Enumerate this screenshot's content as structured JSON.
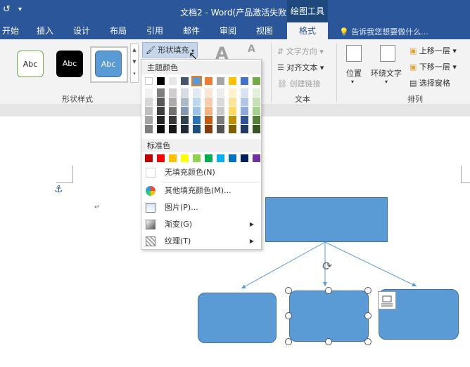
{
  "window": {
    "title": "文档2 - Word(产品激活失败)",
    "context_tab_group": "绘图工具"
  },
  "tabs": [
    {
      "label": "开始"
    },
    {
      "label": "插入"
    },
    {
      "label": "设计"
    },
    {
      "label": "布局"
    },
    {
      "label": "引用"
    },
    {
      "label": "邮件"
    },
    {
      "label": "审阅"
    },
    {
      "label": "视图"
    },
    {
      "label": "格式"
    }
  ],
  "tell_me": "告诉我您想要做什么...",
  "ribbon": {
    "shape_styles": {
      "label": "形状样式",
      "swatches": [
        "Abc",
        "Abc",
        "Abc"
      ],
      "shape_fill": "形状填充"
    },
    "text": {
      "label": "文本",
      "text_direction": "文字方向",
      "align_text": "对齐文本",
      "create_link": "创建链接"
    },
    "arrange": {
      "label": "排列",
      "position": "位置",
      "wrap_text": "环绕文字",
      "bring_forward": "上移一层",
      "send_backward": "下移一层",
      "selection_pane": "选择窗格"
    }
  },
  "fill_menu": {
    "theme_colors_label": "主题颜色",
    "standard_colors_label": "标准色",
    "theme_colors": [
      "#ffffff",
      "#000000",
      "#e7e6e6",
      "#44546a",
      "#5b9bd5",
      "#ed7d31",
      "#a5a5a5",
      "#ffc000",
      "#4472c4",
      "#70ad47"
    ],
    "theme_tints": [
      [
        "#f2f2f2",
        "#7f7f7f",
        "#d0cece",
        "#d6dce4",
        "#deebf6",
        "#fbe5d5",
        "#ededed",
        "#fff2cc",
        "#d9e2f3",
        "#e2efd9"
      ],
      [
        "#d8d8d8",
        "#595959",
        "#aeabab",
        "#adb9ca",
        "#bdd7ee",
        "#f7cbac",
        "#dbdbdb",
        "#fee599",
        "#b4c6e7",
        "#c5e0b3"
      ],
      [
        "#bfbfbf",
        "#3f3f3f",
        "#757070",
        "#8496b0",
        "#9cc3e5",
        "#f4b183",
        "#c9c9c9",
        "#ffd965",
        "#8eaadb",
        "#a8d08d"
      ],
      [
        "#a5a5a5",
        "#262626",
        "#3a3838",
        "#323f4f",
        "#2e75b5",
        "#c55a11",
        "#7b7b7b",
        "#bf9000",
        "#2f5496",
        "#538135"
      ],
      [
        "#7f7f7f",
        "#0c0c0c",
        "#171616",
        "#222a35",
        "#1e4e79",
        "#833c0b",
        "#525252",
        "#7f6000",
        "#1f3864",
        "#375623"
      ]
    ],
    "standard_colors": [
      "#c00000",
      "#ff0000",
      "#ffc000",
      "#ffff00",
      "#92d050",
      "#00b050",
      "#00b0f0",
      "#0070c0",
      "#002060",
      "#7030a0"
    ],
    "no_fill": "无填充颜色(N)",
    "more_colors": "其他填充颜色(M)...",
    "picture": "图片(P)...",
    "gradient": "渐变(G)",
    "texture": "纹理(T)"
  },
  "accent_color": "#2b579a",
  "shape_color": "#5b9bd5"
}
